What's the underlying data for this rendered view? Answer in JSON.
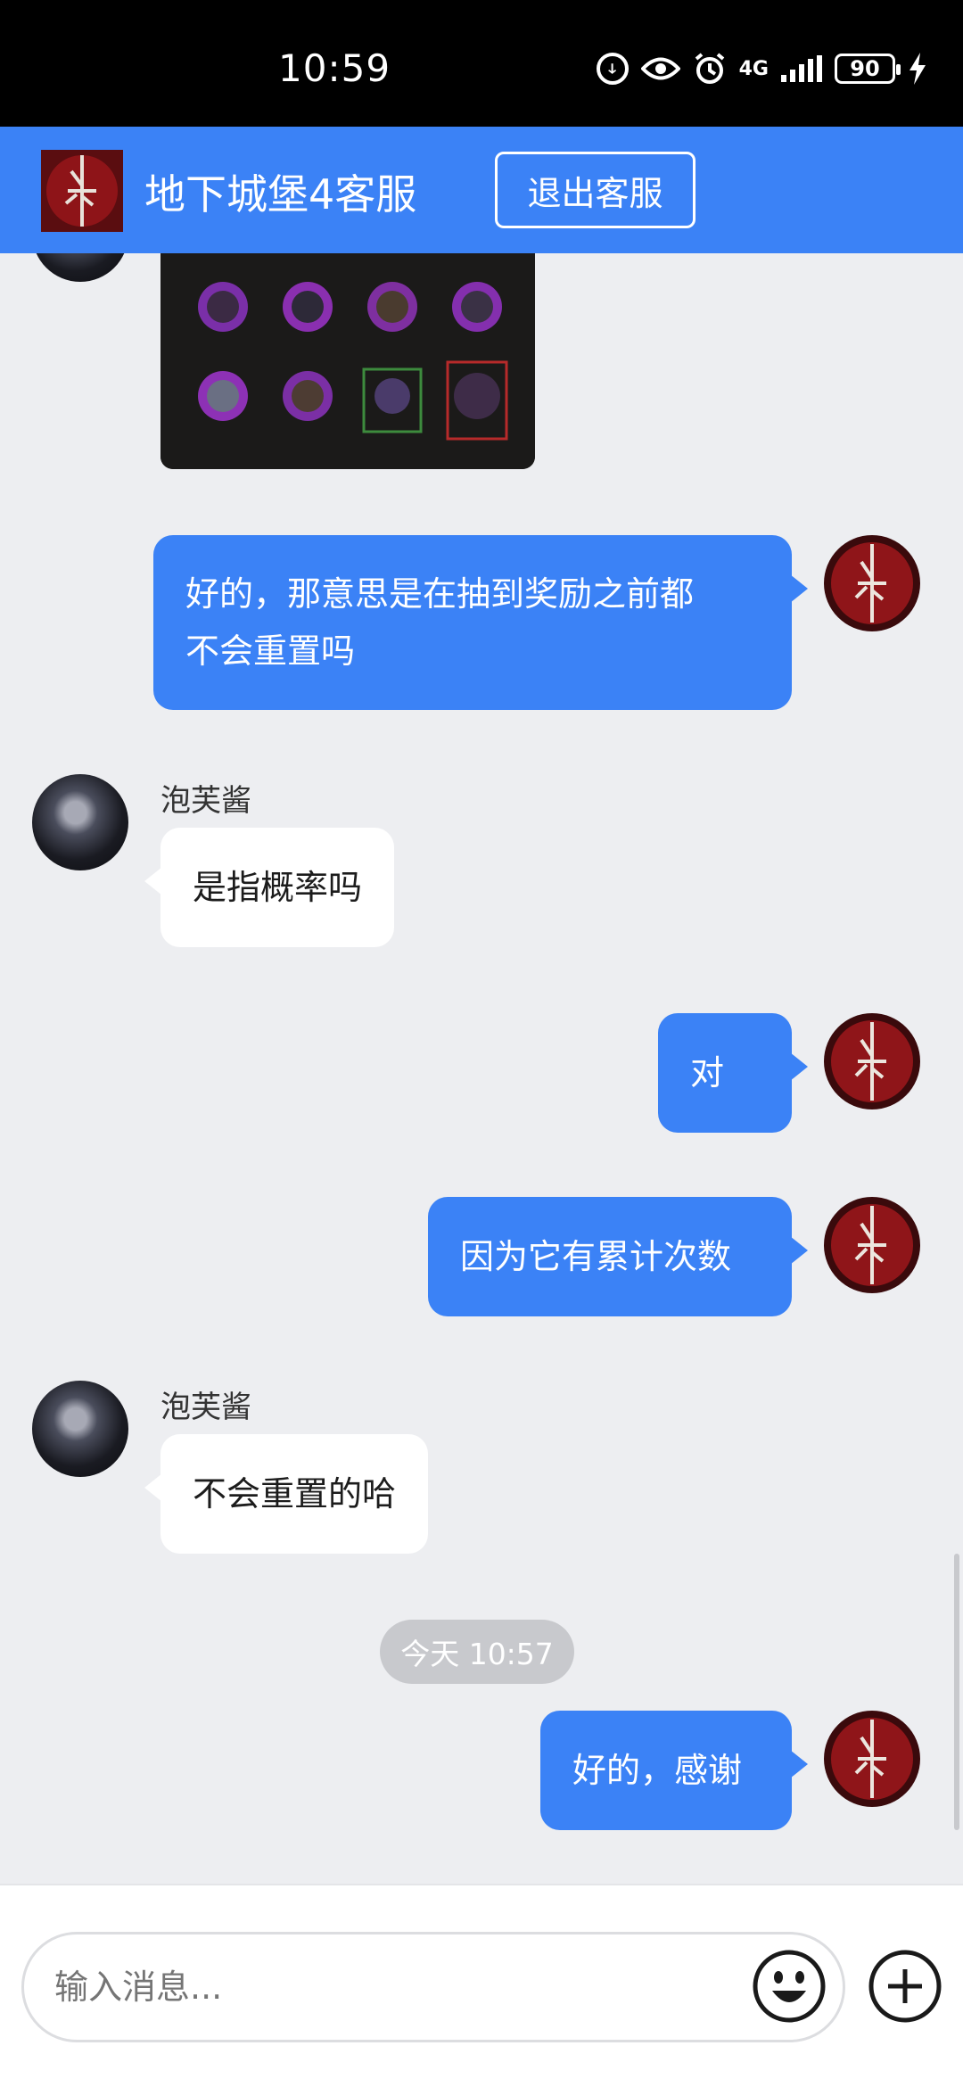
{
  "status_bar": {
    "time": "10:59",
    "network": "4G",
    "battery": "90"
  },
  "header": {
    "title": "地下城堡4客服",
    "exit_label": "退出客服",
    "accent": "#3b82f6"
  },
  "messages": [
    {
      "direction": "in",
      "type": "image",
      "content": "游戏截图"
    },
    {
      "direction": "out",
      "lines": [
        "好的，那意思是在抽到奖励之前都",
        "不会重置吗"
      ]
    },
    {
      "direction": "in",
      "sender": "泡芙酱",
      "text": "是指概率吗"
    },
    {
      "direction": "out",
      "text": "对"
    },
    {
      "direction": "out",
      "text": "因为它有累计次数"
    },
    {
      "direction": "in",
      "sender": "泡芙酱",
      "text": "不会重置的哈"
    },
    {
      "direction": "out",
      "text": "好的，感谢"
    }
  ],
  "timestamp": "今天 10:57",
  "input": {
    "placeholder": "输入消息..."
  },
  "icons": {
    "app_logo": "dungeon-castle-logo-icon",
    "emoji": "emoji-icon",
    "add": "plus-icon"
  }
}
